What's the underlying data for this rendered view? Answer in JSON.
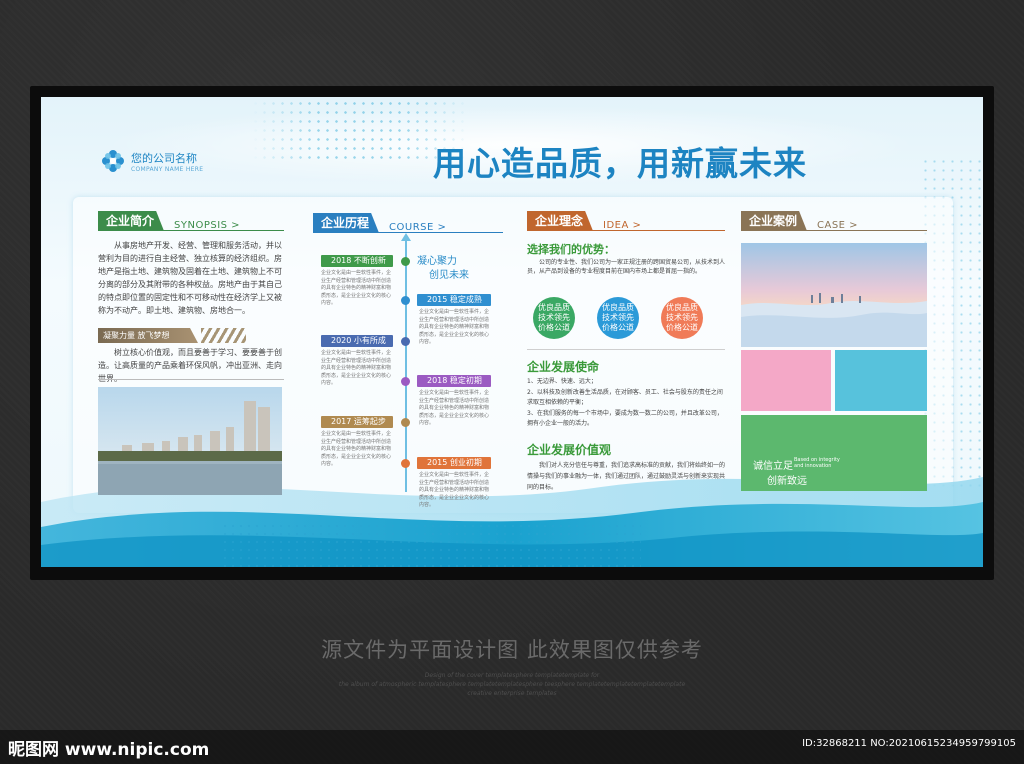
{
  "logo": {
    "name": "您的公司名称",
    "sub": "COMPANY NAME HERE"
  },
  "headline": "用心造品质，用新赢未来",
  "sections": {
    "intro": {
      "tag": "企业简介",
      "en": "SYNOPSIS >",
      "color": "#3c8c4a"
    },
    "course": {
      "tag": "企业历程",
      "en": "COURSE >",
      "color": "#2a7fc0"
    },
    "idea": {
      "tag": "企业理念",
      "en": "IDEA >",
      "color": "#c0662e"
    },
    "case": {
      "tag": "企业案例",
      "en": "CASE >",
      "color": "#8a7456"
    }
  },
  "intro": {
    "paragraph": "从事房地产开发、经营、管理和服务活动，并以营利为目的进行自主经营、独立核算的经济组织。房地产是指土地、建筑物及固着在土地、建筑物上不可分离的部分及其附带的各种权益。房地产由于其自己的特点即位置的固定性和不可移动性在经济学上又被称为不动产。即土地、建筑物、房地合一。",
    "subtag": "凝聚力量 放飞梦想",
    "sub_paragraph": "树立核心价值观，而且要善于学习、要要善于创造。让高质量的产品乘着环保风帆，冲出亚洲、走向世界。"
  },
  "course": {
    "slogan_1": "凝心聚力",
    "slogan_2": "创见未来",
    "milestones": [
      {
        "label": "2018 不断创新",
        "color": "#3f9a4a",
        "text": "企业文化是由一些软性事件，企业生产经营和管理活动中所创造的具有企业特色的精神财富和物质形态，是企业企业文化的核心内容。"
      },
      {
        "label": "2015 稳定成熟",
        "color": "#2f8fd0",
        "text": "企业文化是由一些软性事件，企业生产经营和管理活动中所创造的具有企业特色的精神财富和物质形态，是企业企业文化的核心内容。"
      },
      {
        "label": "2020 小有所成",
        "color": "#4a6bb0",
        "text": "企业文化是由一些软性事件，企业生产经营和管理活动中所创造的具有企业特色的精神财富和物质形态，是企业企业文化的核心内容。"
      },
      {
        "label": "2018 稳定初期",
        "color": "#9b5bc2",
        "text": "企业文化是由一些软性事件，企业生产经营和管理活动中所创造的具有企业特色的精神财富和物质形态，是企业企业文化的核心内容。"
      },
      {
        "label": "2017 运筹起步",
        "color": "#b08a50",
        "text": "企业文化是由一些软性事件，企业生产经营和管理活动中所创造的具有企业特色的精神财富和物质形态，是企业企业文化的核心内容。"
      },
      {
        "label": "2015 创业初期",
        "color": "#e0743a",
        "text": "企业文化是由一些软性事件，企业生产经营和管理活动中所创造的具有企业特色的精神财富和物质形态，是企业企业文化的核心内容。"
      }
    ]
  },
  "idea": {
    "adv_title": "选择我们的优势：",
    "adv_text": "公司的专业性、我们公司为一家正规注册的跨国贸易公司，从技术到人员，从产品到设备的专业程度目前在国内市场上都是首屈一指的。",
    "circles": [
      {
        "text": "优良品质 技术领先 价格公道",
        "color": "#3aa864"
      },
      {
        "text": "优良品质 技术领先 价格公道",
        "color": "#2b9ad8"
      },
      {
        "text": "优良品质 技术领先 价格公道",
        "color": "#f07b58"
      }
    ],
    "mission_title": "企业发展使命",
    "mission_items": [
      "1、无边界、快速、远大；",
      "2、以科技及创新改善生活品质，在对顾客、员工、社会与股东的责任之间求取互相依赖的平衡；",
      "3、在我们服务的每一个市场中，要成为数一数二的公司，并且改革公司，拥有小企业一般的活力。"
    ],
    "value_title": "企业发展价值观",
    "value_text": "我们对人充分信任与尊重，我们追求高标准的贡献，我们将始终如一的情操与我们的事业融为一体，我们通过团队，通过鼓励灵活与创新来实现共同的目标。"
  },
  "case": {
    "slogan_1": "诚信立足",
    "slogan_2": "创新致远",
    "slogan_en_1": "Based on integrity",
    "slogan_en_2": "and innovation"
  },
  "footer": {
    "notice": "源文件为平面设计图 此效果图仅供参考",
    "fine_1": "Design of the cover templatesphere templatetemplate for",
    "fine_2": "the album of atmospheric templatesphere templatetemplatesphere teesphere templatetemplatetemplatetemplate",
    "fine_3": "creative enterprise templates",
    "site": "昵图网 www.nipic.com",
    "id": "ID:32868211 NO:20210615234959799105"
  }
}
